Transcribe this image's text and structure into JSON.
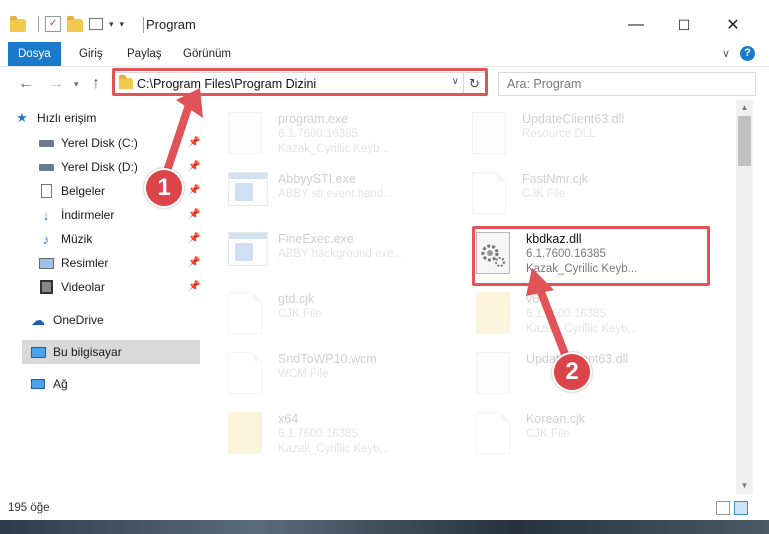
{
  "window": {
    "title": "Program",
    "controls": {
      "minimize": "—",
      "maximize": "☐",
      "close": "✕"
    }
  },
  "ribbon": {
    "tabs": [
      {
        "label": "Dosya",
        "active": true
      },
      {
        "label": "Giriş",
        "active": false
      },
      {
        "label": "Paylaş",
        "active": false
      },
      {
        "label": "Görünüm",
        "active": false
      }
    ],
    "help_glyph": "?",
    "expand_glyph": "∨"
  },
  "address": {
    "path": "C:\\Program Files\\Program Dizini",
    "search_placeholder": "Ara: Program"
  },
  "sidebar": {
    "items": [
      {
        "label": "Hızlı erişim",
        "icon": "star-icon"
      },
      {
        "label": "Yerel Disk (C:)",
        "icon": "drive-icon",
        "pinned": true
      },
      {
        "label": "Yerel Disk (D:)",
        "icon": "drive-icon",
        "pinned": true
      },
      {
        "label": "Belgeler",
        "icon": "documents-icon",
        "pinned": true
      },
      {
        "label": "İndirmeler",
        "icon": "download-icon",
        "pinned": true
      },
      {
        "label": "Müzik",
        "icon": "music-icon",
        "pinned": true
      },
      {
        "label": "Resimler",
        "icon": "pictures-icon",
        "pinned": true
      },
      {
        "label": "Videolar",
        "icon": "videos-icon",
        "pinned": true
      },
      {
        "label": "OneDrive",
        "icon": "cloud-icon"
      },
      {
        "label": "Bu bilgisayar",
        "icon": "computer-icon",
        "selected": true
      },
      {
        "label": "Ağ",
        "icon": "network-icon"
      }
    ]
  },
  "files": [
    {
      "name": "program.exe",
      "line2": "6.1.7600.16385",
      "line3": "Kazak_Cyrillic Keyb...",
      "icon": "dll",
      "faded": true
    },
    {
      "name": "UpdateClient63.dll",
      "line2": "Resource DLL",
      "line3": "",
      "icon": "dll",
      "faded": true
    },
    {
      "name": "AbbyySTI.exe",
      "line2": "ABBY sti event hand...",
      "line3": "",
      "icon": "exe",
      "faded": true
    },
    {
      "name": "FastNmr.cjk",
      "line2": "CJK File",
      "line3": "",
      "icon": "doc",
      "faded": true
    },
    {
      "name": "FineExec.exe",
      "line2": "ABBY background exe...",
      "line3": "",
      "icon": "exe",
      "faded": true
    },
    {
      "name": "kbdkaz.dll",
      "line2": "6.1.7600.16385",
      "line3": "Kazak_Cyrillic Keyb...",
      "icon": "dll",
      "faded": false
    },
    {
      "name": "gtd.cjk",
      "line2": "CJK File",
      "line3": "",
      "icon": "doc",
      "faded": true
    },
    {
      "name": "v6",
      "line2": "6.1.7600.16385",
      "line3": "Kazak_Cyrillic Keyb...",
      "icon": "folder",
      "faded": true
    },
    {
      "name": "SndToWP10.wcm",
      "line2": "WCM File",
      "line3": "",
      "icon": "doc",
      "faded": true
    },
    {
      "name": "UpdateClient63.dll",
      "line2": "",
      "line3": "",
      "icon": "dll",
      "faded": true
    },
    {
      "name": "x64",
      "line2": "6.1.7600.16385",
      "line3": "Kazak_Cyrillic Keyb...",
      "icon": "folder",
      "faded": true
    },
    {
      "name": "Korean.cjk",
      "line2": "CJK File",
      "line3": "",
      "icon": "doc",
      "faded": true
    }
  ],
  "status": {
    "item_count": "195 öğe"
  },
  "callouts": [
    {
      "label": "1"
    },
    {
      "label": "2"
    }
  ],
  "colors": {
    "accent": "#1979ca",
    "highlight": "#e05357"
  }
}
